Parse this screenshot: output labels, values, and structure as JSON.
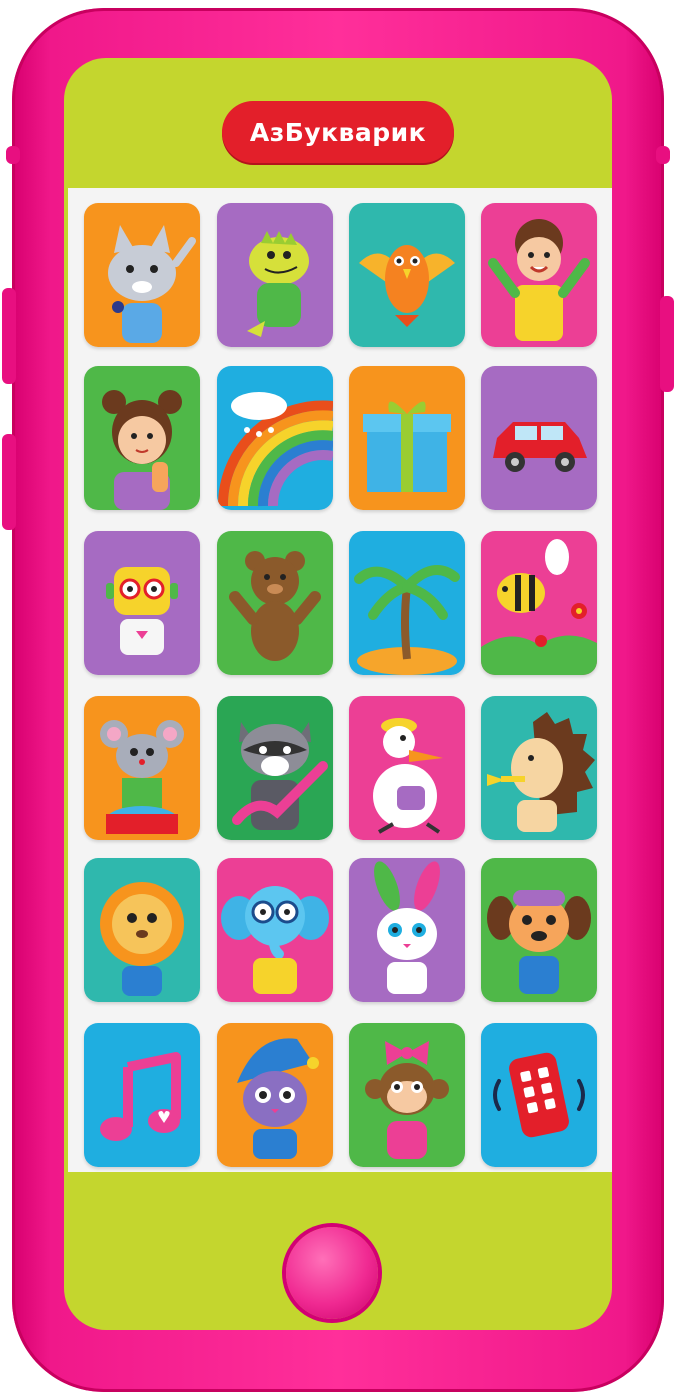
{
  "brand": {
    "logo_text": "АзБукварик"
  },
  "colors": {
    "case": "#ff2f9a",
    "screen": "#c4d62e",
    "logo_badge": "#e31f2a",
    "orange": "#f7941d",
    "purple": "#a66bc2",
    "teal": "#2fb8ad",
    "pink": "#ec3f95",
    "green": "#4fb848",
    "blue": "#1faee0"
  },
  "tiles": [
    {
      "row": 1,
      "col": 1,
      "bg": "orange",
      "icon": "cat-singer-icon"
    },
    {
      "row": 1,
      "col": 2,
      "bg": "purple",
      "icon": "dinosaur-icon"
    },
    {
      "row": 1,
      "col": 3,
      "bg": "teal",
      "icon": "parrot-icon"
    },
    {
      "row": 1,
      "col": 4,
      "bg": "pink",
      "icon": "boy-icon"
    },
    {
      "row": 2,
      "col": 1,
      "bg": "green",
      "icon": "girl-icecream-icon"
    },
    {
      "row": 2,
      "col": 2,
      "bg": "blue",
      "icon": "rainbow-icon"
    },
    {
      "row": 2,
      "col": 3,
      "bg": "orange",
      "icon": "gift-icon"
    },
    {
      "row": 2,
      "col": 4,
      "bg": "purple",
      "icon": "car-icon"
    },
    {
      "row": 3,
      "col": 1,
      "bg": "purple",
      "icon": "robot-icon"
    },
    {
      "row": 3,
      "col": 2,
      "bg": "green",
      "icon": "bear-icon"
    },
    {
      "row": 3,
      "col": 3,
      "bg": "blue",
      "icon": "palm-tree-icon"
    },
    {
      "row": 3,
      "col": 4,
      "bg": "pink",
      "icon": "bee-icon"
    },
    {
      "row": 4,
      "col": 1,
      "bg": "orange",
      "icon": "mouse-drummer-icon"
    },
    {
      "row": 4,
      "col": 2,
      "bg": "green",
      "icon": "raccoon-guitar-icon"
    },
    {
      "row": 4,
      "col": 3,
      "bg": "pink",
      "icon": "duck-icon"
    },
    {
      "row": 4,
      "col": 4,
      "bg": "teal",
      "icon": "hedgehog-trumpet-icon"
    },
    {
      "row": 5,
      "col": 1,
      "bg": "teal",
      "icon": "lion-icon"
    },
    {
      "row": 5,
      "col": 2,
      "bg": "pink",
      "icon": "elephant-icon"
    },
    {
      "row": 5,
      "col": 3,
      "bg": "purple",
      "icon": "bunny-icon"
    },
    {
      "row": 5,
      "col": 4,
      "bg": "green",
      "icon": "puppy-pilot-icon"
    },
    {
      "row": 6,
      "col": 1,
      "bg": "blue",
      "icon": "music-note-icon"
    },
    {
      "row": 6,
      "col": 2,
      "bg": "orange",
      "icon": "sleepy-cat-icon"
    },
    {
      "row": 6,
      "col": 3,
      "bg": "green",
      "icon": "monkey-icon"
    },
    {
      "row": 6,
      "col": 4,
      "bg": "blue",
      "icon": "phone-vibrate-icon"
    }
  ]
}
